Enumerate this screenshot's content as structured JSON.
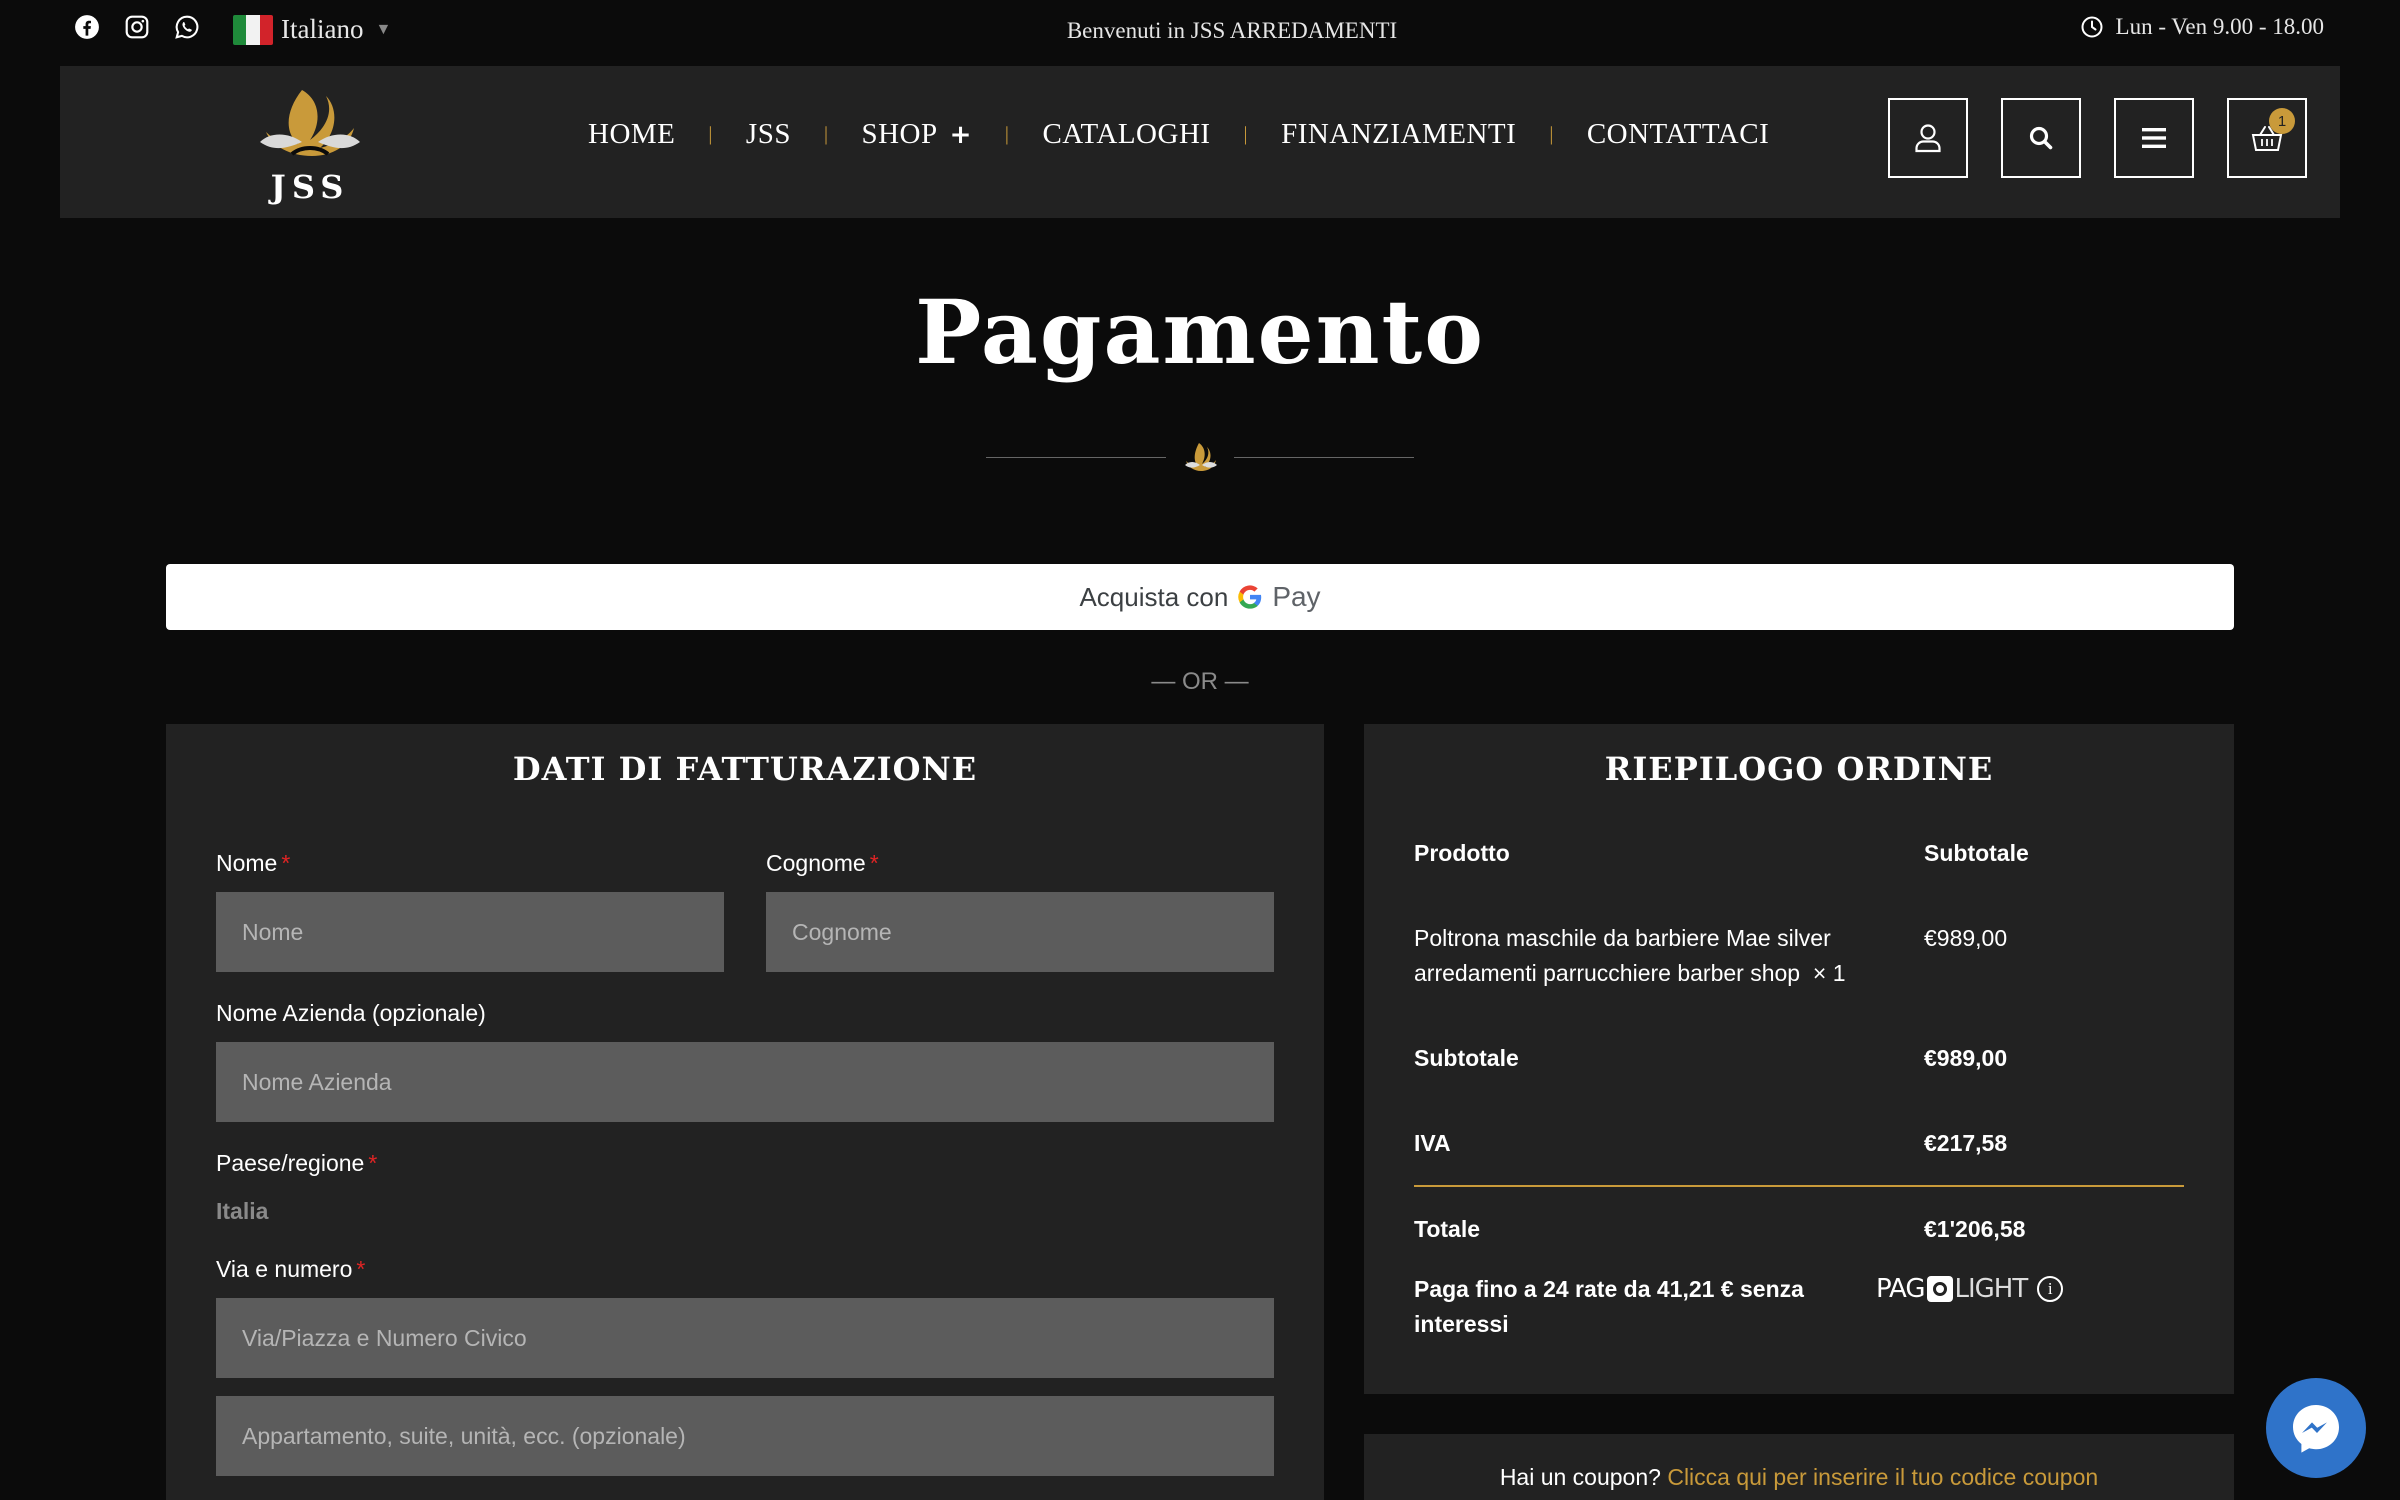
{
  "topbar": {
    "social": [
      "facebook-icon",
      "instagram-icon",
      "whatsapp-icon"
    ],
    "language": "Italiano",
    "welcome": "Benvenuti in JSS ARREDAMENTI",
    "hours": "Lun - Ven 9.00 - 18.00"
  },
  "nav": {
    "logo_text": "JSS",
    "items": [
      {
        "label": "HOME"
      },
      {
        "label": "JSS"
      },
      {
        "label": "SHOP"
      },
      {
        "label": "CATALOGHI"
      },
      {
        "label": "FINANZIAMENTI"
      },
      {
        "label": "CONTATTACI"
      }
    ],
    "shop_expand": "+",
    "cart_count": "1"
  },
  "page": {
    "title": "Pagamento"
  },
  "gpay": {
    "prefix": "Acquista con",
    "g": "G",
    "pay": "Pay"
  },
  "or_text": "— OR —",
  "billing": {
    "title": "DATI DI FATTURAZIONE",
    "required_mark": "*",
    "first_name": {
      "label": "Nome",
      "placeholder": "Nome"
    },
    "last_name": {
      "label": "Cognome",
      "placeholder": "Cognome"
    },
    "company": {
      "label": "Nome Azienda (opzionale)",
      "placeholder": "Nome Azienda"
    },
    "country": {
      "label": "Paese/regione",
      "value": "Italia"
    },
    "street": {
      "label": "Via e numero",
      "placeholder": "Via/Piazza e Numero Civico",
      "placeholder2": "Appartamento, suite, unità, ecc. (opzionale)"
    }
  },
  "summary": {
    "title": "RIEPILOGO ORDINE",
    "col_product": "Prodotto",
    "col_subtotal": "Subtotale",
    "product_line1": "Poltrona maschile da barbiere Mae silver",
    "product_line2": "arredamenti parrucchiere barber shop",
    "product_qty": "× 1",
    "product_price": "€989,00",
    "subtotal_label": "Subtotale",
    "subtotal_value": "€989,00",
    "iva_label": "IVA",
    "iva_value": "€217,58",
    "total_label": "Totale",
    "total_value": "€1'206,58",
    "installments_line1": "Paga fino a 24 rate da 41,21 € senza",
    "installments_line2": "interessi",
    "pago_a": "PAG",
    "pago_b": "LIGHT"
  },
  "coupon": {
    "question": "Hai un coupon?",
    "link": "Clicca qui per inserire il tuo codice coupon"
  },
  "colors": {
    "accent_gold": "#c99a3a",
    "panel": "#222222",
    "background": "#0b0b0b",
    "input_bg": "#5c5c5c",
    "required_red": "#e02424",
    "messenger_blue": "#2f73c9"
  }
}
